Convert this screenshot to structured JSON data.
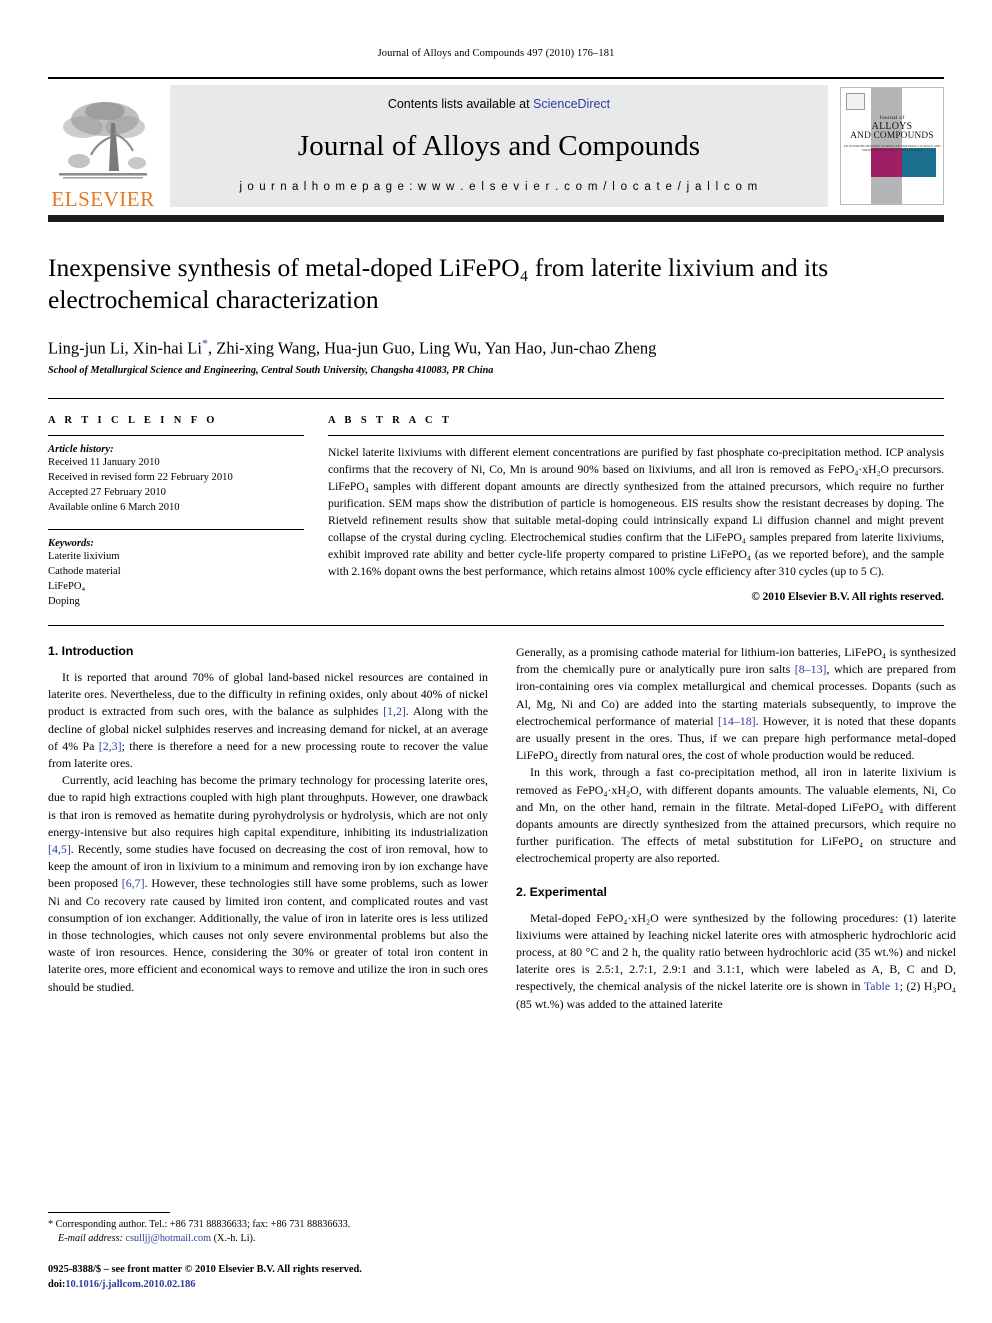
{
  "running_head": "Journal of Alloys and Compounds 497 (2010) 176–181",
  "masthead": {
    "publisher_wordmark": "ELSEVIER",
    "contents_prefix": "Contents lists available at ",
    "contents_link": "ScienceDirect",
    "journal_name": "Journal of Alloys and Compounds",
    "homepage_label": "j o u r n a l   h o m e p a g e :",
    "homepage_url": "w w w . e l s e v i e r . c o m / l o c a t e / j a l l c o m",
    "cover": {
      "line1": "Journal of",
      "line2": "ALLOYS",
      "line3": "AND COMPOUNDS",
      "line4": "AN INTERDISCIPLINARY JOURNAL OF MATERIALS SCIENCE AND SOLID-STATE CHEMISTRY AND PHYSICS",
      "band_color": "#b4b5b7",
      "magenta_color": "#9e1f63",
      "teal_color": "#1a6e8e"
    },
    "link_color": "#2f3d9e",
    "orange_color": "#E87722"
  },
  "article": {
    "title": "Inexpensive synthesis of metal-doped LiFePO₄ from laterite lixivium and its electrochemical characterization",
    "authors": "Ling-jun Li, Xin-hai Li",
    "authors_rest": ", Zhi-xing Wang, Hua-jun Guo, Ling Wu, Yan Hao, Jun-chao Zheng",
    "corresponding_marker": "*",
    "affiliation": "School of Metallurgical Science and Engineering, Central South University, Changsha 410083, PR China"
  },
  "article_info": {
    "heading": "A R T I C L E   I N F O",
    "history_title": "Article history:",
    "history": [
      "Received 11 January 2010",
      "Received in revised form 22 February 2010",
      "Accepted 27 February 2010",
      "Available online 6 March 2010"
    ],
    "keywords_title": "Keywords:",
    "keywords": [
      "Laterite lixivium",
      "Cathode material",
      "LiFePO₄",
      "Doping"
    ]
  },
  "abstract": {
    "heading": "A B S T R A C T",
    "text": "Nickel laterite lixiviums with different element concentrations are purified by fast phosphate co-precipitation method. ICP analysis confirms that the recovery of Ni, Co, Mn is around 90% based on lixiviums, and all iron is removed as FePO₄·xH₂O precursors. LiFePO₄ samples with different dopant amounts are directly synthesized from the attained precursors, which require no further purification. SEM maps show the distribution of particle is homogeneous. EIS results show the resistant decreases by doping. The Rietveld refinement results show that suitable metal-doping could intrinsically expand Li diffusion channel and might prevent collapse of the crystal during cycling. Electrochemical studies confirm that the LiFePO₄ samples prepared from laterite lixiviums, exhibit improved rate ability and better cycle-life property compared to pristine LiFePO₄ (as we reported before), and the sample with 2.16% dopant owns the best performance, which retains almost 100% cycle efficiency after 310 cycles (up to 5 C).",
    "copyright": "© 2010 Elsevier B.V. All rights reserved."
  },
  "sections": {
    "introduction_heading": "1.  Introduction",
    "experimental_heading": "2.  Experimental"
  },
  "body": {
    "intro_p1_a": "It is reported that around 70% of global land-based nickel resources are contained in laterite ores. Nevertheless, due to the difficulty in refining oxides, only about 40% of nickel product is extracted from such ores, with the balance as sulphides ",
    "intro_p1_cite1": "[1,2]",
    "intro_p1_b": ". Along with the decline of global nickel sulphides reserves and increasing demand for nickel, at an average of 4% Pa ",
    "intro_p1_cite2": "[2,3]",
    "intro_p1_c": "; there is therefore a need for a new processing route to recover the value from laterite ores.",
    "intro_p2_a": "Currently, acid leaching has become the primary technology for processing laterite ores, due to rapid high extractions coupled with high plant throughputs. However, one drawback is that iron is removed as hematite during pyrohydrolysis or hydrolysis, which are not only energy-intensive but also requires high capital expenditure, inhibiting its industrialization ",
    "intro_p2_cite1": "[4,5]",
    "intro_p2_b": ". Recently, some studies have focused on decreasing the cost of iron removal, how to keep the amount of iron in lixivium to a minimum and removing iron by ion exchange have been proposed ",
    "intro_p2_cite2": "[6,7]",
    "intro_p2_c": ". However, these technologies still have some problems, such as lower Ni and Co recovery rate caused by limited iron content, and complicated routes and vast consumption of ion exchanger. Additionally, the value of iron in laterite ores is less utilized in those technologies, which causes not only severe environmental problems but also the waste of iron resources. Hence, considering the 30% or greater of total iron content in laterite ores, more efficient and economical ways to remove and utilize the iron in such ores should be studied.",
    "intro_p3_a": "Generally, as a promising cathode material for lithium-ion batteries, LiFePO₄ is synthesized from the chemically pure or analytically pure iron salts ",
    "intro_p3_cite1": "[8–13]",
    "intro_p3_b": ", which are prepared from iron-containing ores via complex metallurgical and chemical processes. Dopants (such as Al, Mg, Ni and Co) are added into the starting materials subsequently, to improve the electrochemical performance of material ",
    "intro_p3_cite2": "[14–18]",
    "intro_p3_c": ". However, it is noted that these dopants are usually present in the ores. Thus, if we can prepare high performance metal-doped LiFePO₄ directly from natural ores, the cost of whole production would be reduced.",
    "intro_p4": "In this work, through a fast co-precipitation method, all iron in laterite lixivium is removed as FePO₄·xH₂O, with different dopants amounts. The valuable elements, Ni, Co and Mn, on the other hand, remain in the filtrate. Metal-doped LiFePO₄ with different dopants amounts are directly synthesized from the attained precursors, which require no further purification. The effects of metal substitution for LiFePO₄ on structure and electrochemical property are also reported.",
    "exp_p1_a": "Metal-doped FePO₄·xH₂O were synthesized by the following procedures: (1) laterite lixiviums were attained by leaching nickel laterite ores with atmospheric hydrochloric acid process, at 80 °C and 2 h, the quality ratio between hydrochloric acid (35 wt.%) and nickel laterite ores is 2.5:1, 2.7:1, 2.9:1 and 3.1:1, which were labeled as A, B, C and D, respectively, the chemical analysis of the nickel laterite ore is shown in ",
    "exp_p1_link": "Table 1",
    "exp_p1_b": "; (2) H₃PO₄ (85 wt.%) was added to the attained laterite"
  },
  "footnotes": {
    "corresponding": "* Corresponding author. Tel.: +86 731 88836633; fax: +86 731 88836633.",
    "email_label": "E-mail address:",
    "email": "csulljj@hotmail.com",
    "email_suffix": " (X.-h. Li).",
    "issn_line": "0925-8388/$ – see front matter © 2010 Elsevier B.V. All rights reserved.",
    "doi_label": "doi:",
    "doi": "10.1016/j.jallcom.2010.02.186"
  }
}
